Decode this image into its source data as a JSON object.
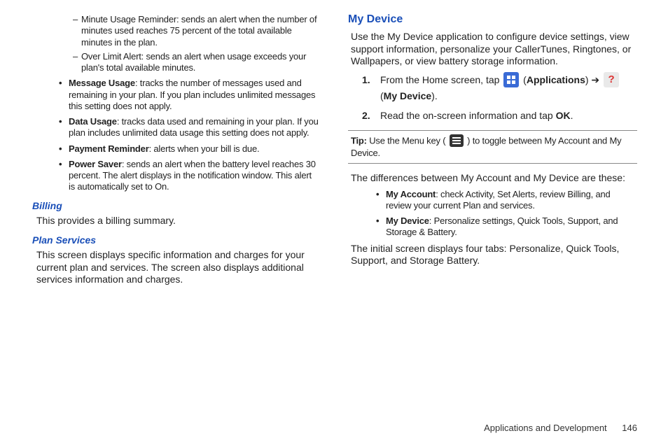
{
  "left": {
    "dash1": "Minute Usage Reminder: sends an alert when the number of minutes used reaches 75 percent of the total available minutes in the plan.",
    "dash2": "Over Limit Alert: sends an alert when usage exceeds your plan's total available minutes.",
    "b1_label": "Message Usage",
    "b1_text": ": tracks the number of messages used and remaining in your plan. If you plan includes unlimited messages this setting does not apply.",
    "b2_label": "Data Usage",
    "b2_text": ": tracks data used and remaining in your plan. If you plan includes unlimited data usage this setting does not apply.",
    "b3_label": "Payment Reminder",
    "b3_text": ": alerts when your bill is due.",
    "b4_label": "Power Saver",
    "b4_text": ": sends an alert when the battery level reaches 30 percent. The alert displays in the notification window. This alert is automatically set to On.",
    "billing_h": "Billing",
    "billing_p": "This provides a billing summary.",
    "plan_h": "Plan Services",
    "plan_p": "This screen displays specific information and charges for your current plan and services. The screen also displays additional services information and charges."
  },
  "right": {
    "heading": "My Device",
    "intro": "Use the My Device application to configure device settings, view support information, personalize your CallerTunes, Ringtones, or Wallpapers, or view battery storage information.",
    "step1_num": "1.",
    "step1_a": "From the Home screen, tap ",
    "step1_apps": "Applications",
    "step1_arrow": " ➔ ",
    "step1_dev": "My Device",
    "step2_num": "2.",
    "step2_a": "Read the on-screen information and tap ",
    "step2_ok": "OK",
    "tip_label": "Tip:",
    "tip_a": " Use the Menu key ( ",
    "tip_b": " ) to toggle between My Account and My Device.",
    "diff_intro": "The differences between My Account and My Device are these:",
    "d1_label": "My Account",
    "d1_text": ": check Activity, Set Alerts, review Billing, and review your current Plan and services.",
    "d2_label": "My Device",
    "d2_text": ": Personalize settings, Quick Tools, Support, and Storage & Battery.",
    "closing": "The initial screen displays four tabs: Personalize, Quick Tools, Support, and Storage Battery."
  },
  "footer": {
    "chapter": "Applications and Development",
    "page": "146"
  }
}
